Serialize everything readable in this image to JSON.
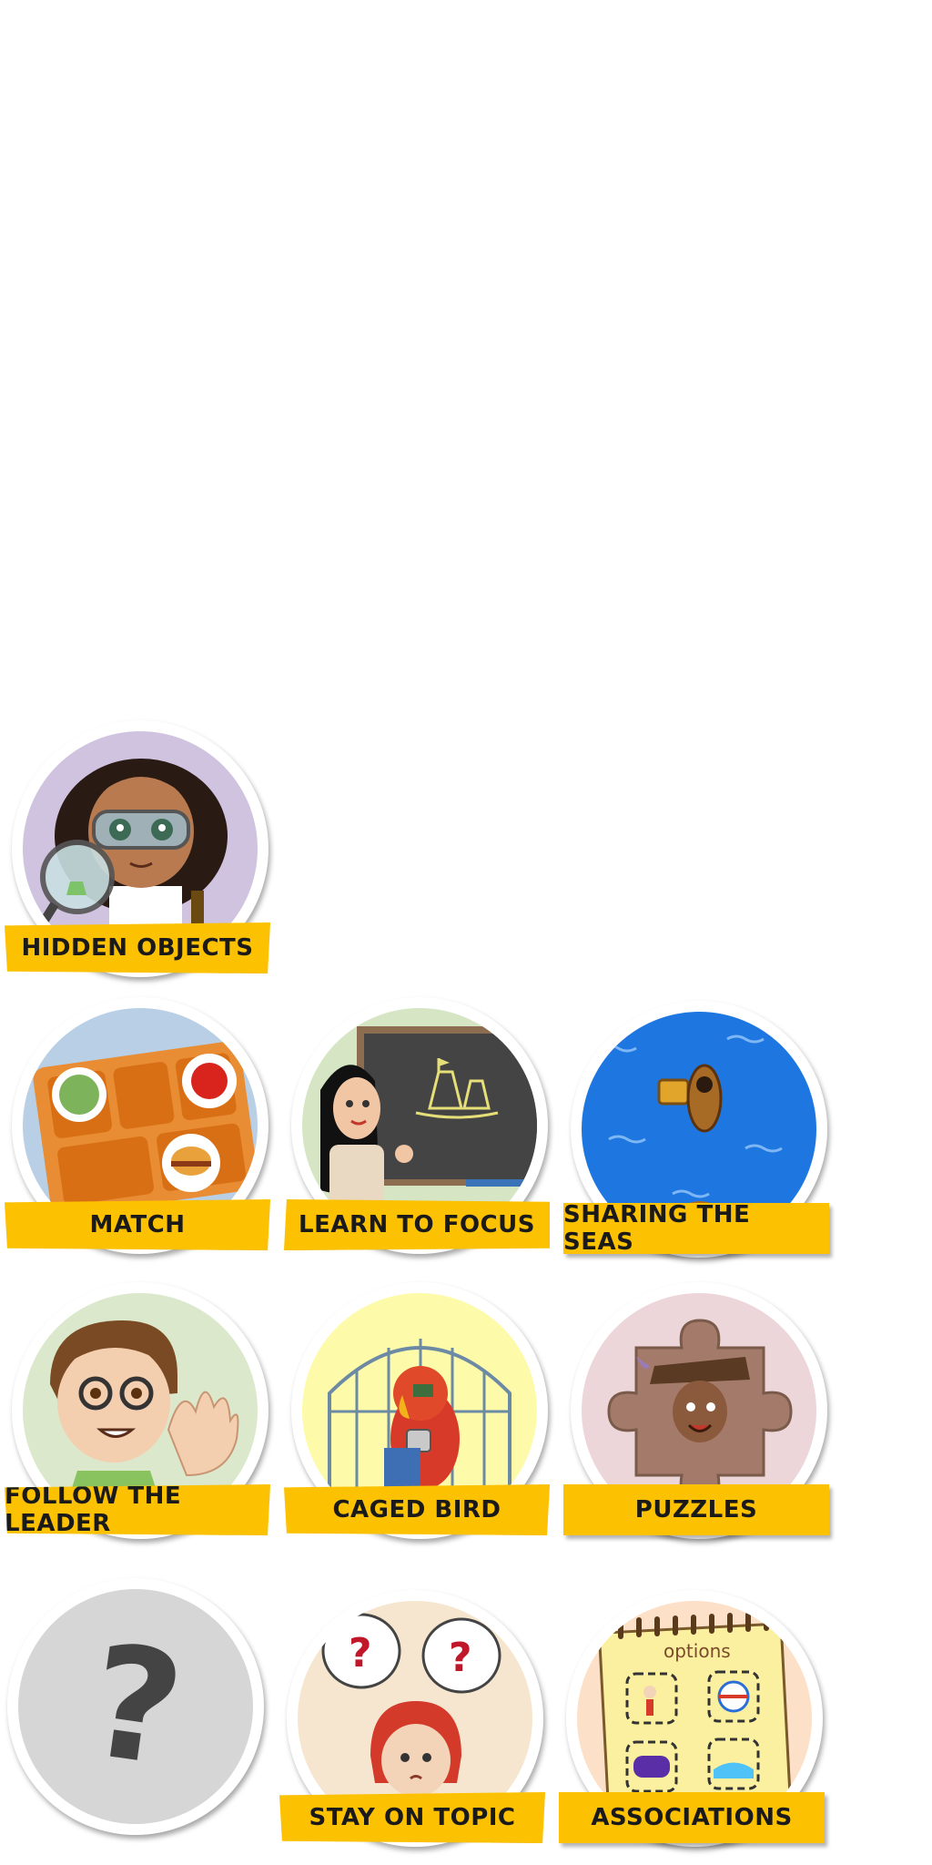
{
  "games": [
    {
      "id": "hidden-objects",
      "label": "HIDDEN OBJECTS",
      "bg": "#cfc3e0",
      "icon": "scientist-girl-magnifier-icon"
    },
    {
      "id": "match",
      "label": "MATCH",
      "bg": "#b9cfe6",
      "icon": "lunch-tray-icon"
    },
    {
      "id": "learn-to-focus",
      "label": "LEARN TO FOCUS",
      "bg": "#d6e6c4",
      "icon": "teacher-chalkboard-icon"
    },
    {
      "id": "sharing-the-seas",
      "label": "SHARING THE SEAS",
      "bg": "#1e77e0",
      "icon": "pirate-ship-sea-icon"
    },
    {
      "id": "follow-the-leader",
      "label": "FOLLOW THE LEADER",
      "bg": "#dbe8cb",
      "icon": "waving-boy-icon"
    },
    {
      "id": "caged-bird",
      "label": "CAGED BIRD",
      "bg": "#fdfbaa",
      "icon": "parrot-in-cage-icon"
    },
    {
      "id": "puzzles",
      "label": "PUZZLES",
      "bg": "#ecd6d9",
      "icon": "puzzle-piece-pirate-icon"
    },
    {
      "id": "locked",
      "label": "",
      "bg": "#d6d6d6",
      "icon": "question-mark-icon",
      "glyph": "?"
    },
    {
      "id": "stay-on-topic",
      "label": "STAY ON TOPIC",
      "bg": "#f6e6cf",
      "icon": "confused-girl-question-bubbles-icon",
      "bubble_glyph": "?"
    },
    {
      "id": "associations",
      "label": "ASSOCIATIONS",
      "bg": "#fde0c8",
      "icon": "options-notepad-icon",
      "notepad_title": "options"
    }
  ],
  "colors": {
    "banner": "#fcc100",
    "banner_text": "#1a1a1a",
    "card_border": "#ffffff"
  }
}
